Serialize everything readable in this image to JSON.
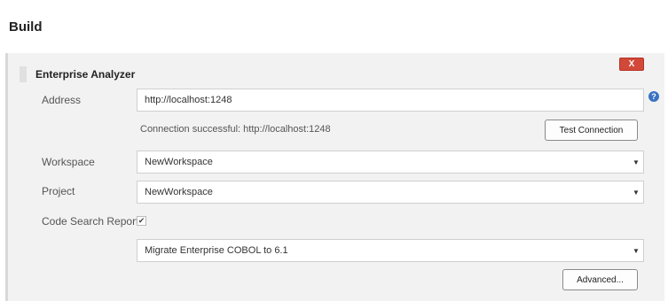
{
  "page": {
    "title": "Build"
  },
  "section": {
    "title": "Enterprise Analyzer",
    "delete_label": "X"
  },
  "address": {
    "label": "Address",
    "value": "http://localhost:1248",
    "help_icon": "?"
  },
  "connection": {
    "status": "Connection successful: http://localhost:1248",
    "test_button": "Test Connection"
  },
  "workspace": {
    "label": "Workspace",
    "selected": "NewWorkspace"
  },
  "project": {
    "label": "Project",
    "selected": "NewWorkspace"
  },
  "code_search": {
    "label": "Code Search Report",
    "checked": true,
    "check_glyph": "✔",
    "selected": "Migrate Enterprise COBOL to 6.1"
  },
  "advanced_button": "Advanced...",
  "icons": {
    "dropdown": "▼"
  },
  "colors": {
    "delete": "#d24939",
    "help": "#3a73c4"
  }
}
